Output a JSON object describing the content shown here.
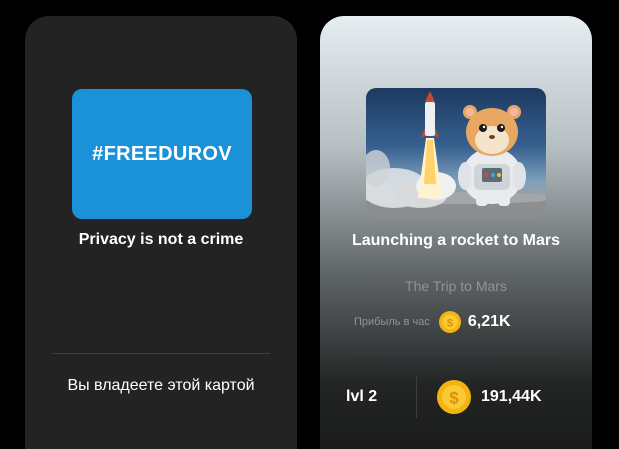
{
  "cards": [
    {
      "banner_text": "#FREEDUROV",
      "title": "Privacy is not a crime",
      "status_text": "Вы владеете этой картой"
    },
    {
      "image_icon": "hamster-rocket-image",
      "title": "Launching a rocket to Mars",
      "subtitle": "The Trip to Mars",
      "profit_label": "Прибыль в час",
      "profit_value": "6,21K",
      "level": "lvl 2",
      "price": "191,44K",
      "coin_icon": "coin-icon",
      "coin_color": "#f5b30f"
    }
  ]
}
